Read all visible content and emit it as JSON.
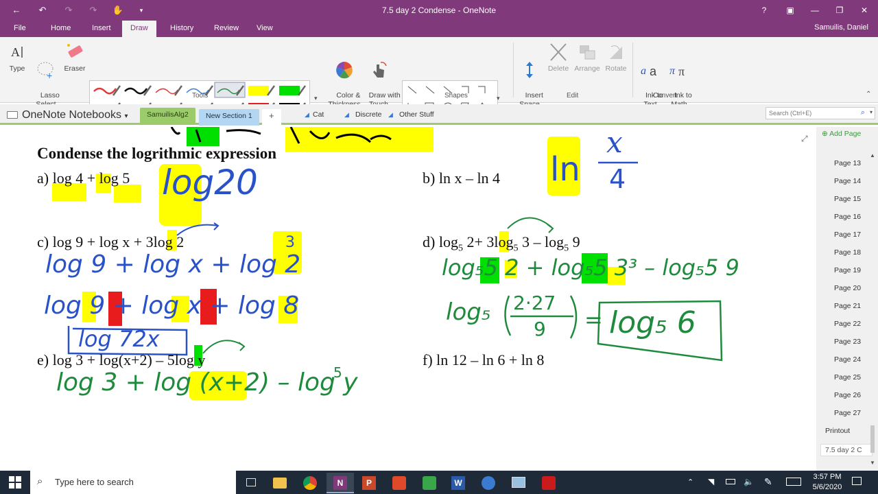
{
  "window": {
    "title": "7.5 day 2 Condense - OneNote",
    "help_glyph": "?",
    "user": "Samuilis, Daniel"
  },
  "menu_tabs": [
    "File",
    "Home",
    "Insert",
    "Draw",
    "History",
    "Review",
    "View"
  ],
  "ribbon": {
    "type_label": "Type",
    "lasso_label": "Lasso\nSelect",
    "eraser_label": "Eraser",
    "color_label": "Color &\nThickness",
    "drawtouch_label": "Draw with\nTouch",
    "insert_space_label": "Insert\nSpace",
    "delete_label": "Delete",
    "arrange_label": "Arrange",
    "rotate_label": "Rotate",
    "ink_text_label": "Ink to\nText",
    "ink_math_label": "Ink to\nMath",
    "groups": {
      "tools": "Tools",
      "shapes": "Shapes",
      "edit": "Edit",
      "convert": "Convert"
    },
    "pens": [
      {
        "color": "#e03a3a",
        "style": "squiggle"
      },
      {
        "color": "#111111",
        "style": "squiggle"
      },
      {
        "color": "#e03a3a",
        "style": "thin"
      },
      {
        "color": "#3a7fd0",
        "style": "thin"
      },
      {
        "color": "#2e8b3e",
        "style": "thin",
        "selected": true
      },
      {
        "color": "#ffff00",
        "style": "highlighter"
      },
      {
        "color": "#00e000",
        "style": "highlighter"
      },
      {
        "color": "#f08020",
        "style": "squiggle"
      },
      {
        "color": "#2a52c8",
        "style": "squiggle"
      },
      {
        "color": "#2e8b3e",
        "style": "squiggle"
      },
      {
        "color": "#22b8d8",
        "style": "squiggle"
      },
      {
        "color": "#7a4a2a",
        "style": "squiggle"
      },
      {
        "color": "#e81c1c",
        "style": "highlighter"
      },
      {
        "color": "#000000",
        "style": "highlighter"
      }
    ]
  },
  "nav": {
    "notebooks_label": "OneNote Notebooks",
    "sections": [
      {
        "label": "SamuilisAlg2",
        "color": "#9bcb6a",
        "active": true
      },
      {
        "label": "New Section 1",
        "color": "#b3d7f2",
        "active": false
      }
    ],
    "add_glyph": "+",
    "shortcuts": [
      "Cat",
      "Discrete",
      "Other Stuff"
    ],
    "search_placeholder": "Search (Ctrl+E)"
  },
  "page": {
    "heading": "Condense the logrithmic expression",
    "problems": {
      "a": "a) log 4 + log 5",
      "b": "b) ln x – ln 4",
      "c": "c) log 9 + log x + 3log 2",
      "d_pre": "d) log",
      "d_sub1": "5",
      "d_mid": " 2+ 3log",
      "d_sub2": "5",
      "d_mid2": " 3 – log",
      "d_sub3": "5",
      "d_end": " 9",
      "e": "e) log 3 + log(x+2) – 5log y",
      "f": "f) ln 12 – ln 6 + ln 8"
    },
    "ink": {
      "a_answer": "log20",
      "b_ln": "ln",
      "b_num": "x",
      "b_den": "4",
      "c_line1": "log 9 + log x + log 2",
      "c_line1_exp": "3",
      "c_line2": "log 9 + log x + log 8",
      "c_answer": "log 72x",
      "d_line1": "log₅5 2 + log₅5 3³ – log₅5 9",
      "d_line2_log": "log₅",
      "d_frac_num": "2·27",
      "d_frac_den": "9",
      "d_eq": "=",
      "d_answer": "log₅ 6",
      "e_line": "log 3 + log (x+2) – log y",
      "e_exp": "5"
    },
    "highlight": "#ffff00",
    "ink_blue": "#2a52c8",
    "ink_green": "#1e8a3c"
  },
  "sidebar": {
    "add_page": "Add Page",
    "pages": [
      "Page 13",
      "Page 14",
      "Page 15",
      "Page 16",
      "Page 17",
      "Page 18",
      "Page 19",
      "Page 20",
      "Page 21",
      "Page 22",
      "Page 23",
      "Page 24",
      "Page 25",
      "Page 26",
      "Page 27",
      "Printout",
      "7.5 day 2 C"
    ],
    "selected_index": 16
  },
  "taskbar": {
    "search_placeholder": "Type here to search",
    "time": "3:57 PM",
    "date": "5/6/2020"
  }
}
